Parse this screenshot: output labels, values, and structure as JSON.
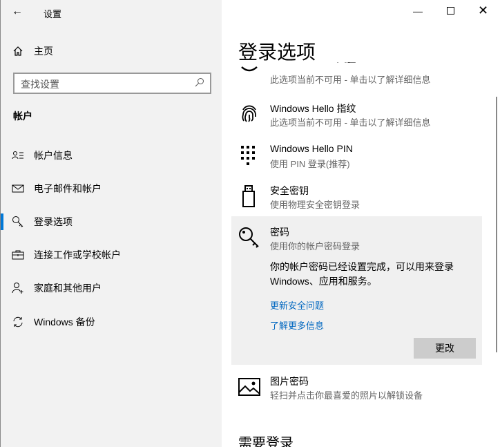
{
  "window": {
    "title": "设置"
  },
  "sidebar": {
    "home": "主页",
    "search_placeholder": "查找设置",
    "section": "帐户",
    "items": [
      {
        "label": "帐户信息",
        "icon": "account-info-icon"
      },
      {
        "label": "电子邮件和帐户",
        "icon": "mail-icon"
      },
      {
        "label": "登录选项",
        "icon": "key-icon"
      },
      {
        "label": "连接工作或学校帐户",
        "icon": "briefcase-icon"
      },
      {
        "label": "家庭和其他用户",
        "icon": "add-user-icon"
      },
      {
        "label": "Windows 备份",
        "icon": "sync-icon"
      }
    ],
    "selected": "登录选项"
  },
  "main": {
    "title": "登录选项",
    "options": [
      {
        "title": "Windows Hello 人脸",
        "subtitle": "此选项当前不可用 - 单击以了解详细信息"
      },
      {
        "title": "Windows Hello 指纹",
        "subtitle": "此选项当前不可用 - 单击以了解详细信息"
      },
      {
        "title": "Windows Hello PIN",
        "subtitle": "使用 PIN 登录(推荐)"
      },
      {
        "title": "安全密钥",
        "subtitle": "使用物理安全密钥登录"
      },
      {
        "title": "密码",
        "subtitle": "使用你的帐户密码登录"
      },
      {
        "title": "图片密码",
        "subtitle": "轻扫并点击你最喜爱的照片以解锁设备"
      }
    ],
    "password_detail": "你的帐户密码已经设置完成，可以用来登录 Windows、应用和服务。",
    "link_security": "更新安全问题",
    "link_more": "了解更多信息",
    "change_button": "更改",
    "next_section": "需要登录"
  },
  "colors": {
    "accent": "#0078d7",
    "link": "#0067c0"
  }
}
